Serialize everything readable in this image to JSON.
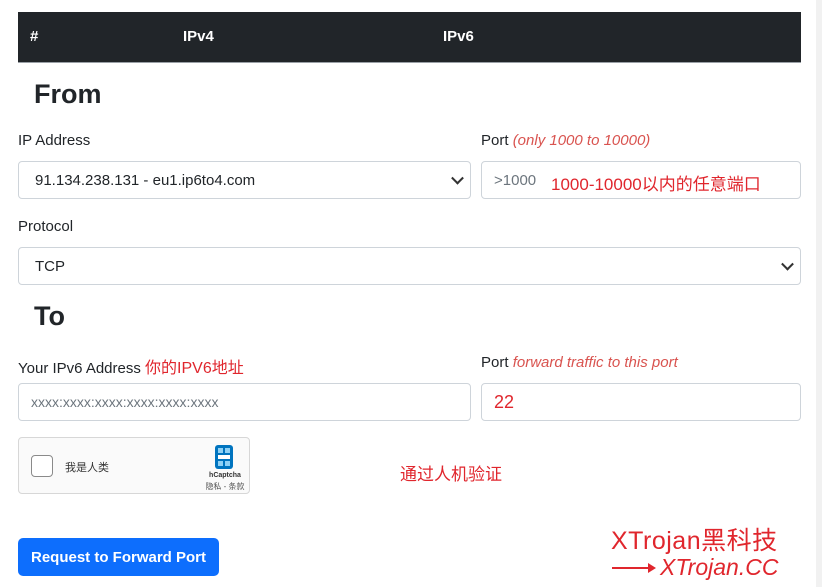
{
  "table": {
    "col_hash": "#",
    "col_ipv4": "IPv4",
    "col_ipv6": "IPv6"
  },
  "from": {
    "title": "From",
    "ip_label": "IP Address",
    "ip_value": "91.134.238.131 - eu1.ip6to4.com",
    "port_label": "Port",
    "port_hint": "(only 1000 to 10000)",
    "port_placeholder": ">1000",
    "port_annotation": "1000-10000以内的任意端口",
    "protocol_label": "Protocol",
    "protocol_value": "TCP"
  },
  "to": {
    "title": "To",
    "ipv6_label": "Your IPv6 Address",
    "ipv6_annotation": "你的IPV6地址",
    "ipv6_placeholder": "xxxx:xxxx:xxxx:xxxx:xxxx:xxxx",
    "port_label": "Port",
    "port_hint": "forward traffic to this port",
    "port_value": "22"
  },
  "captcha": {
    "checkbox_label": "我是人类",
    "brand": "hCaptcha",
    "links": "隐私 - 条款",
    "annotation": "通过人机验证"
  },
  "submit_label": "Request to Forward Port",
  "watermark": {
    "line1": "XTrojan黑科技",
    "line2": "XTrojan.CC"
  },
  "colors": {
    "header_bg": "#212529",
    "primary": "#0d6efd",
    "annotation": "#e0262d"
  }
}
